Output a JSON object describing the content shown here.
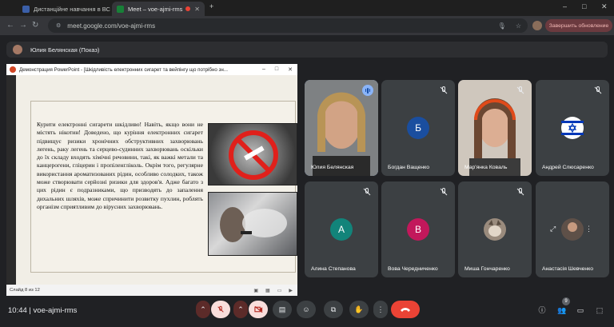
{
  "browser": {
    "tabs": [
      {
        "label": "Дистанційне навчання в ВСП",
        "favicon_color": "#3b5fa8"
      },
      {
        "label": "Meet – voe-ajmi-rms",
        "favicon_color": "#188038"
      }
    ],
    "url": "meet.google.com/voe-ajmi-rms",
    "update_button": "Завершить обновление",
    "window_controls": [
      "–",
      "□",
      "✕"
    ]
  },
  "meet": {
    "presenter_banner": "Юлия Белянская (Показ)",
    "ppt": {
      "window_title": "Демонстрация PowerPoint - [Шкідливість електронних сигарет та вейпінгу що потрібно зн...",
      "slide_text": "Курити електронні сигарети шкідливо! Навіть, якщо вони не містять нікотин! Доведено, що куріння електронних сигарет підвищує ризики хронічних обструктивних захворювань легень, раку легень та серцево-судинних захворювань оскільки до їх складу входять хімічні речовини, такі, як важкі метали та канцерогени, гліцерин і пропіленгліколь. Окрім того, регулярне використання ароматизованих рідин, особливо солодких, також може створювати серйозні ризики для здоров'я. Адже багато з цих рідин є подразниками, що призводять до запалення дихальних шляхів, може спричинити розвитку пухлин, роблять організм сприятливим до вірусних захворювань.",
      "status_left": "Слайд 8 из 12"
    },
    "participants": [
      {
        "name": "Юлия Белянская",
        "kind": "video",
        "speaking": true
      },
      {
        "name": "Богдан Ващенко",
        "kind": "initial",
        "initial": "Б",
        "color": "#1a4e9f",
        "muted": true
      },
      {
        "name": "Мар'янка Коваль",
        "kind": "video",
        "muted": true
      },
      {
        "name": "Андрей Слюсаренко",
        "kind": "flag",
        "muted": true
      },
      {
        "name": "Алина Степанова",
        "kind": "initial",
        "initial": "А",
        "color": "#12847a",
        "muted": true
      },
      {
        "name": "Вова Чередниченко",
        "kind": "initial",
        "initial": "В",
        "color": "#c2185b",
        "muted": true
      },
      {
        "name": "Миша Гончаренко",
        "kind": "avatar",
        "muted": true
      },
      {
        "name": "Анастасія Шевченко",
        "kind": "avatar",
        "muted": true
      }
    ],
    "bottom": {
      "time": "10:44",
      "meeting_code": "voe-ajmi-rms",
      "participants_count": "9"
    }
  },
  "colors": {
    "accent_red": "#ea4335",
    "speaking_blue": "#8ab4f8",
    "tile_bg": "#3c4043"
  }
}
